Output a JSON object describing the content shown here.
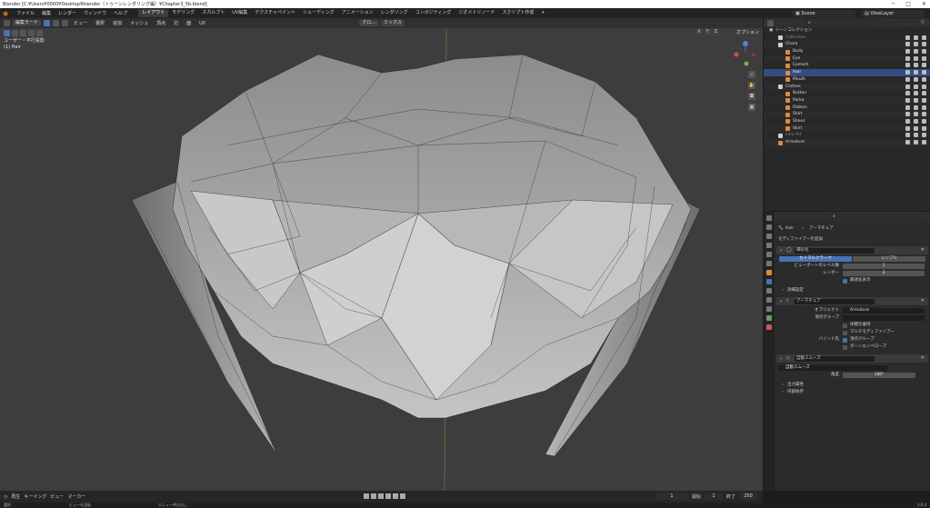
{
  "window": {
    "title": "Blender [C:¥Users¥0000¥Desktop¥blender（トゥーンレンダリング編）¥Chapter3_5b.blend]"
  },
  "menu": [
    "ファイル",
    "編集",
    "レンダー",
    "ウィンドウ",
    "ヘルプ"
  ],
  "workspace_tabs": [
    {
      "label": "レイアウト",
      "active": true
    },
    {
      "label": "モデリング"
    },
    {
      "label": "スカルプト"
    },
    {
      "label": "UV編集"
    },
    {
      "label": "テクスチャペイント"
    },
    {
      "label": "シェーディング"
    },
    {
      "label": "アニメーション"
    },
    {
      "label": "レンダリング"
    },
    {
      "label": "コンポジティング"
    },
    {
      "label": "ジオメトリノード"
    },
    {
      "label": "スクリプト作成"
    },
    {
      "label": "+"
    }
  ],
  "topbar_right": {
    "scene": "Scene",
    "view_layer": "ViewLayer"
  },
  "viewport": {
    "mode": "編集モード",
    "menus": [
      "ビュー",
      "選択",
      "追加",
      "メッシュ",
      "頂点",
      "辺",
      "面",
      "UV"
    ],
    "transform": "グロ...",
    "snap": "ミックス",
    "options": "オプション",
    "axes": [
      "X",
      "Y",
      "Z"
    ],
    "info_line1": "ユーザー・平行投影",
    "info_line2": "(1) Hair"
  },
  "timeline": {
    "items": [
      "再生",
      "キーイング",
      "ビュー",
      "マーカー"
    ],
    "current_frame": "1",
    "start_label": "開始",
    "start": "1",
    "end_label": "終了",
    "end": "250"
  },
  "statusbar": {
    "select": "選択",
    "rotate_view": "ビューを回転",
    "context_menu": "エニュー呼び出し",
    "version": "3.6.4"
  },
  "outliner": {
    "header": "シーンコレクション",
    "rows": [
      {
        "label": "Collection",
        "indent": 1,
        "dim": true,
        "icon": "collection-icon"
      },
      {
        "label": "Chara",
        "indent": 1,
        "icon": "collection-icon"
      },
      {
        "label": "Body",
        "indent": 2,
        "icon": "mesh-icon"
      },
      {
        "label": "Eye",
        "indent": 2,
        "icon": "mesh-icon"
      },
      {
        "label": "Eyelash",
        "indent": 2,
        "icon": "mesh-icon"
      },
      {
        "label": "Hair",
        "indent": 2,
        "icon": "mesh-icon",
        "selected": true
      },
      {
        "label": "Mouth",
        "indent": 2,
        "icon": "mesh-icon"
      },
      {
        "label": "Clothes",
        "indent": 1,
        "icon": "collection-icon"
      },
      {
        "label": "Button",
        "indent": 2,
        "icon": "mesh-icon"
      },
      {
        "label": "Parka",
        "indent": 2,
        "icon": "mesh-icon"
      },
      {
        "label": "Ribbon",
        "indent": 2,
        "icon": "mesh-icon"
      },
      {
        "label": "Shirt",
        "indent": 2,
        "icon": "mesh-icon"
      },
      {
        "label": "Shoes",
        "indent": 2,
        "icon": "mesh-icon"
      },
      {
        "label": "Skirt",
        "indent": 2,
        "icon": "mesh-icon"
      },
      {
        "label": "Line Art",
        "indent": 1,
        "dim": true,
        "icon": "collection-icon"
      },
      {
        "label": "Armature",
        "indent": 1,
        "icon": "armature-icon"
      }
    ]
  },
  "properties": {
    "breadcrumb_object": "Hair",
    "breadcrumb_armature": "アーマチュア",
    "add_modifier": "モディファイアーを追加",
    "subdivision": {
      "name": "細分化",
      "catmull": "カトマルクラーク",
      "simple": "シンプル",
      "viewport_levels_label": "ビューポートのレベル数",
      "viewport_levels": "1",
      "render_label": "レンダー",
      "render": "2",
      "optimal_display": "最適化表示",
      "advanced": "詳細設定"
    },
    "armature": {
      "name": "アーマチュア",
      "object_label": "オブジェクト",
      "object": "Armature",
      "vgroup_label": "頂点グループ",
      "preserve_volume": "体積を維持",
      "multi_modifier": "マルチモディファイアー",
      "bind_label": "バインド先",
      "vertex_groups": "頂点グループ",
      "bone_envelopes": "ボーンエンベロープ"
    },
    "autosmooth": {
      "name": "自動スムーズ",
      "node_group": "自動スムーズ",
      "angle_label": "角度",
      "angle": "180°",
      "output_attrs": "出力属性",
      "internal": "内部依存"
    }
  }
}
